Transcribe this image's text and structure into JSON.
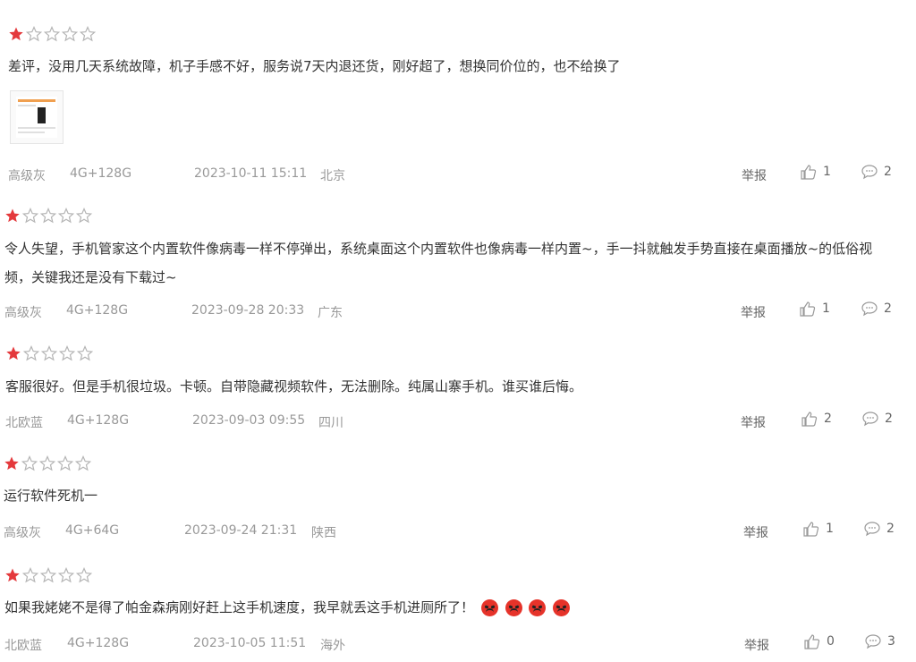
{
  "colors": {
    "star_filled": "#e4393c",
    "star_empty": "#bbbbbb",
    "meta_text": "#999999",
    "body_text": "#333333"
  },
  "icons": {
    "like": "thumbs-up-icon",
    "comment": "comment-bubble-icon",
    "star": "star-icon",
    "emoji": "angry-face-emoji"
  },
  "reviews": [
    {
      "rating": 1,
      "text": "差评，没用几天系统故障，机子手感不好，服务说7天内退还货，刚好超了，想换同价位的，也不给换了",
      "color": "高级灰",
      "spec": "4G+128G",
      "time": "2023-10-11 15:11",
      "location": "北京",
      "report": "举报",
      "likes": "1",
      "comments": "2",
      "has_image": true
    },
    {
      "rating": 1,
      "text": "令人失望，手机管家这个内置软件像病毒一样不停弹出，系统桌面这个内置软件也像病毒一样内置~，手一抖就触发手势直接在桌面播放~的低俗视频，关键我还是没有下载过~",
      "color": "高级灰",
      "spec": "4G+128G",
      "time": "2023-09-28 20:33",
      "location": "广东",
      "report": "举报",
      "likes": "1",
      "comments": "2"
    },
    {
      "rating": 1,
      "text": "客服很好。但是手机很垃圾。卡顿。自带隐藏视频软件，无法删除。纯属山寨手机。谁买谁后悔。",
      "color": "北欧蓝",
      "spec": "4G+128G",
      "time": "2023-09-03 09:55",
      "location": "四川",
      "report": "举报",
      "likes": "2",
      "comments": "2"
    },
    {
      "rating": 1,
      "text": "运行软件死机一",
      "color": "高级灰",
      "spec": "4G+64G",
      "time": "2023-09-24 21:31",
      "location": "陕西",
      "report": "举报",
      "likes": "1",
      "comments": "2"
    },
    {
      "rating": 1,
      "text": "如果我姥姥不是得了帕金森病刚好赶上这手机速度，我早就丢这手机进厕所了！",
      "emoji_count": 4,
      "color": "北欧蓝",
      "spec": "4G+128G",
      "time": "2023-10-05 11:51",
      "location": "海外",
      "report": "举报",
      "likes": "0",
      "comments": "3"
    }
  ]
}
